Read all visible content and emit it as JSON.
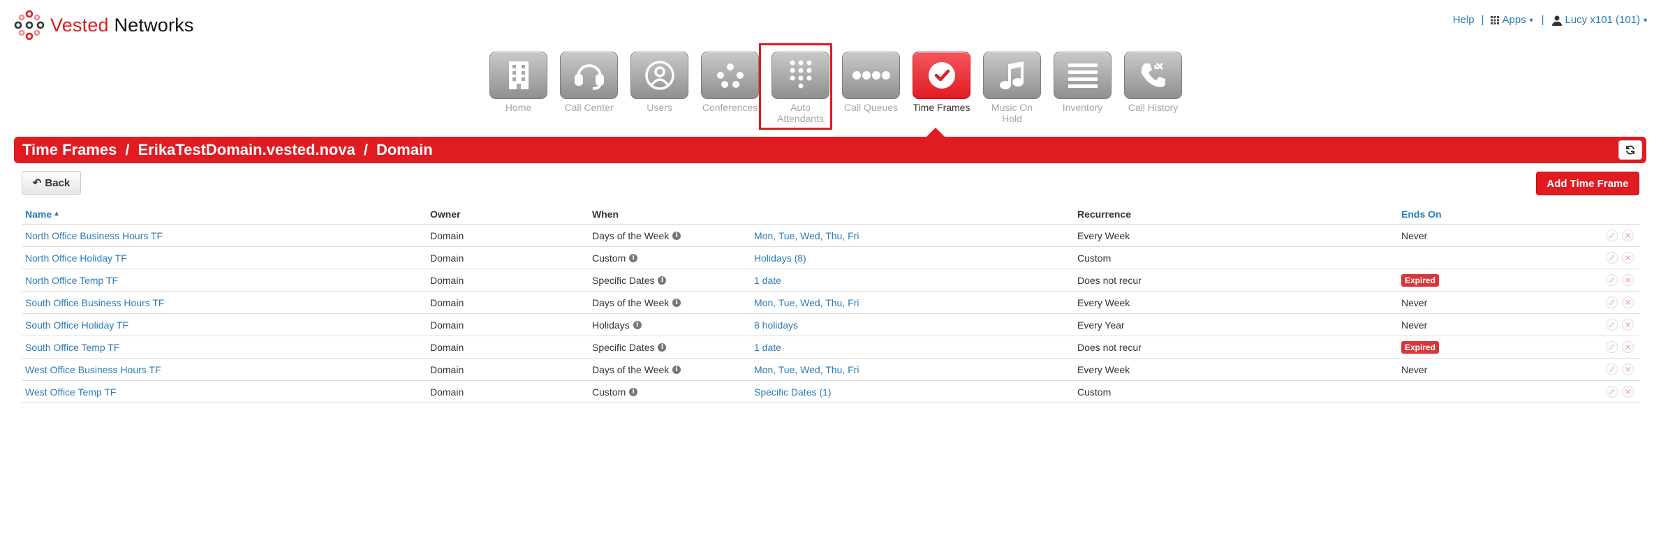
{
  "brand": {
    "part1": "Vested",
    "part2": " Networks"
  },
  "toplinks": {
    "help": "Help",
    "sep1": "|",
    "apps": "Apps",
    "sep2": "|",
    "user": "Lucy x101 (101)"
  },
  "nav": [
    {
      "label": "Home",
      "icon": "building-icon"
    },
    {
      "label": "Call Center",
      "icon": "headset-icon"
    },
    {
      "label": "Users",
      "icon": "users-icon"
    },
    {
      "label": "Conferences",
      "icon": "conference-icon"
    },
    {
      "label": "Auto Attendants",
      "icon": "keypad-icon"
    },
    {
      "label": "Call Queues",
      "icon": "queue-dots-icon"
    },
    {
      "label": "Time Frames",
      "icon": "clock-icon"
    },
    {
      "label": "Music On Hold",
      "icon": "music-note-icon"
    },
    {
      "label": "Inventory",
      "icon": "list-icon"
    },
    {
      "label": "Call History",
      "icon": "phone-history-icon"
    }
  ],
  "breadcrumb": {
    "a": "Time Frames",
    "b": "ErikaTestDomain.vested.nova",
    "c": "Domain",
    "slash": "/"
  },
  "actions": {
    "back": "Back",
    "add": "Add Time Frame"
  },
  "table": {
    "headers": {
      "name": "Name",
      "owner": "Owner",
      "when": "When",
      "recurrence": "Recurrence",
      "ends_on": "Ends On"
    },
    "rows": [
      {
        "name": "North Office Business Hours TF",
        "owner": "Domain",
        "when": "Days of the Week",
        "detail": "Mon, Tue, Wed, Thu, Fri",
        "recurrence": "Every Week",
        "ends": "Never",
        "expired": ""
      },
      {
        "name": "North Office Holiday TF",
        "owner": "Domain",
        "when": "Custom",
        "detail": "Holidays (8)",
        "recurrence": "Custom",
        "ends": "",
        "expired": ""
      },
      {
        "name": "North Office Temp TF",
        "owner": "Domain",
        "when": "Specific Dates",
        "detail": "1 date",
        "recurrence": "Does not recur",
        "ends": "",
        "expired": "Expired"
      },
      {
        "name": "South Office Business Hours TF",
        "owner": "Domain",
        "when": "Days of the Week",
        "detail": "Mon, Tue, Wed, Thu, Fri",
        "recurrence": "Every Week",
        "ends": "Never",
        "expired": ""
      },
      {
        "name": "South Office Holiday TF",
        "owner": "Domain",
        "when": "Holidays",
        "detail": "8 holidays",
        "recurrence": "Every Year",
        "ends": "Never",
        "expired": ""
      },
      {
        "name": "South Office Temp TF",
        "owner": "Domain",
        "when": "Specific Dates",
        "detail": "1 date",
        "recurrence": "Does not recur",
        "ends": "",
        "expired": "Expired"
      },
      {
        "name": "West Office Business Hours TF",
        "owner": "Domain",
        "when": "Days of the Week",
        "detail": "Mon, Tue, Wed, Thu, Fri",
        "recurrence": "Every Week",
        "ends": "Never",
        "expired": ""
      },
      {
        "name": "West Office Temp TF",
        "owner": "Domain",
        "when": "Custom",
        "detail": "Specific Dates (1)",
        "recurrence": "Custom",
        "ends": "",
        "expired": ""
      }
    ]
  },
  "colors": {
    "brand_red": "#e11b22",
    "link_blue": "#2a7ab8",
    "nav_gray": "#a6a6a6"
  }
}
